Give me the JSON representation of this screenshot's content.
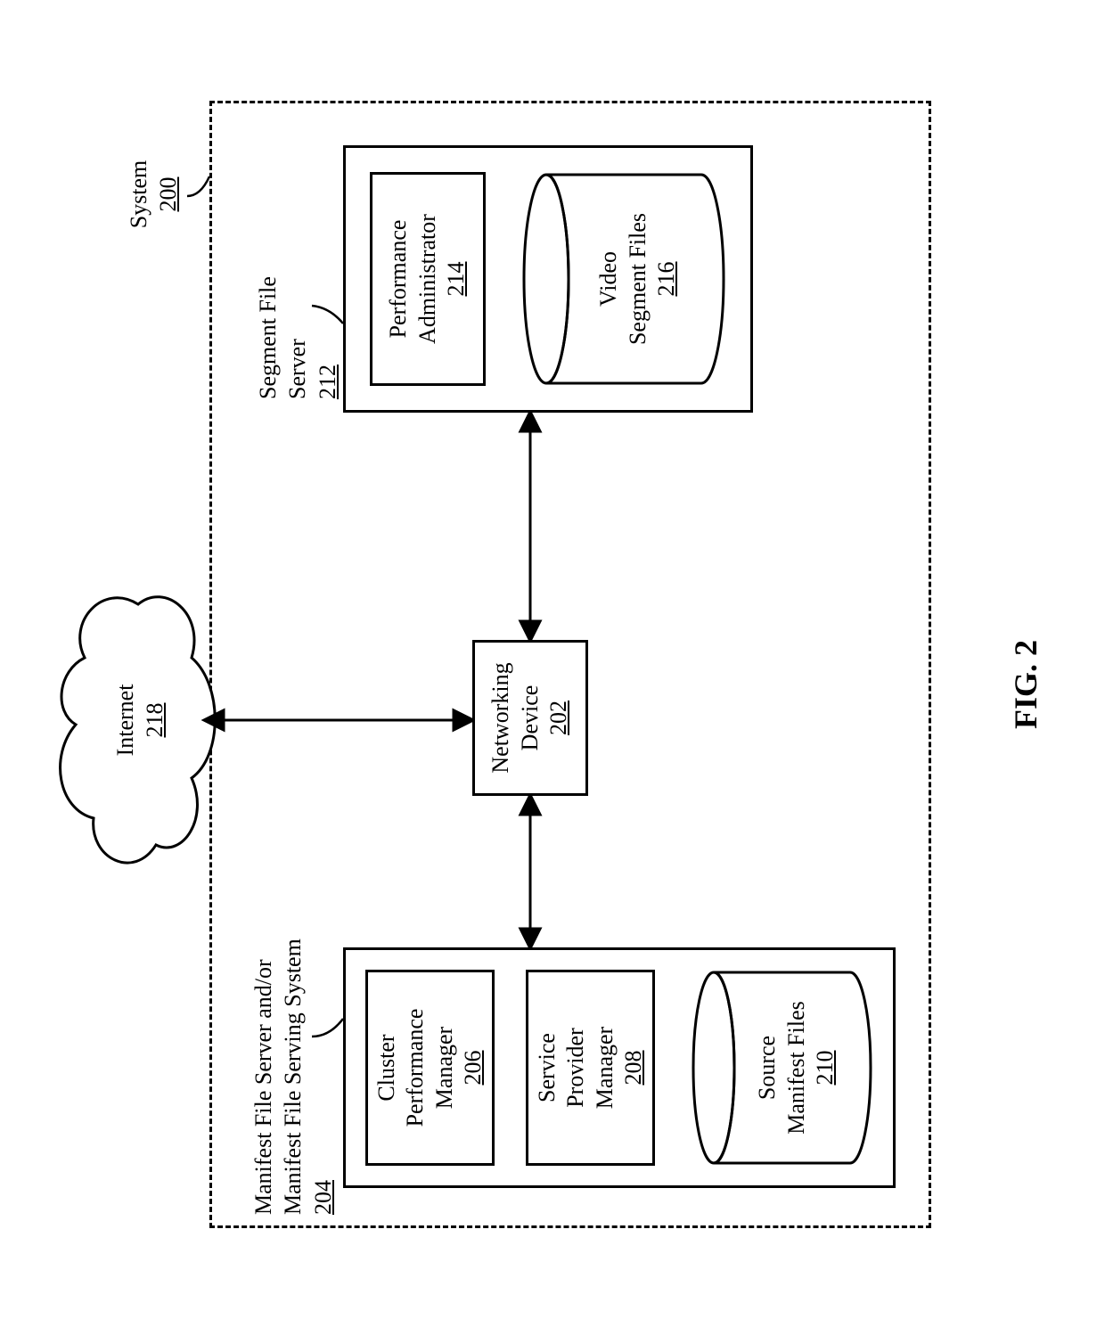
{
  "figure_label": "FIG. 2",
  "system": {
    "label": "System",
    "ref": "200"
  },
  "internet": {
    "label": "Internet",
    "ref": "218"
  },
  "networking_device": {
    "label": "Networking\nDevice",
    "ref": "202"
  },
  "manifest_server": {
    "label": "Manifest File Server and/or\nManifest File Serving System",
    "ref": "204",
    "cluster_perf_mgr": {
      "label": "Cluster\nPerformance\nManager",
      "ref": "206"
    },
    "service_provider_mgr": {
      "label": "Service\nProvider\nManager",
      "ref": "208"
    },
    "source_manifest_files": {
      "label": "Source\nManifest Files",
      "ref": "210"
    }
  },
  "segment_server": {
    "label": "Segment File\nServer",
    "ref": "212",
    "perf_admin": {
      "label": "Performance\nAdministrator",
      "ref": "214"
    },
    "video_segment_files": {
      "label": "Video\nSegment Files",
      "ref": "216"
    }
  }
}
